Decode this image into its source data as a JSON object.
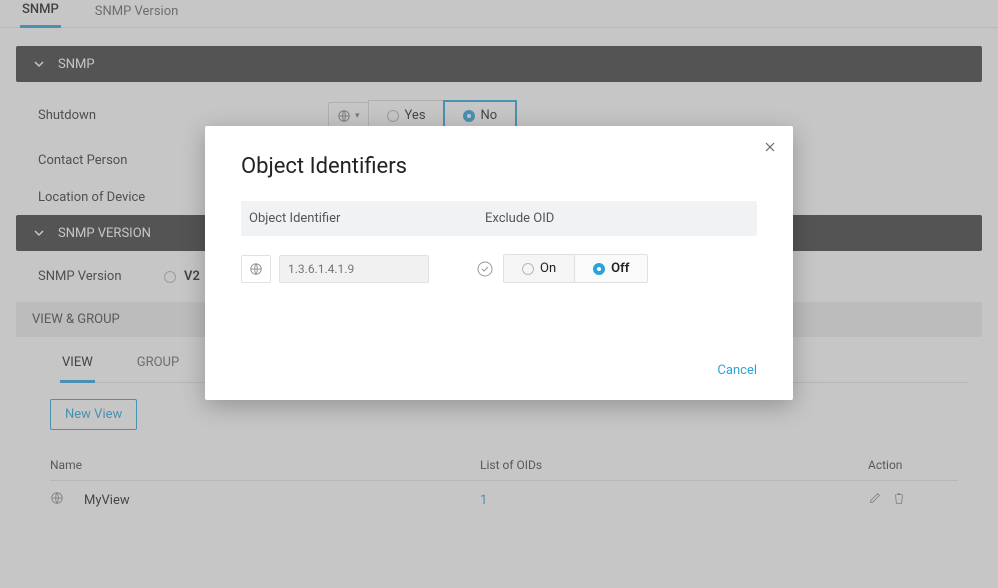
{
  "tabs": {
    "snmp": "SNMP",
    "version": "SNMP Version"
  },
  "panel1": {
    "title": "SNMP",
    "shutdown_label": "Shutdown",
    "yes": "Yes",
    "no": "No",
    "contact_label": "Contact Person",
    "location_label": "Location of Device"
  },
  "panel2": {
    "title": "SNMP VERSION",
    "ver_label": "SNMP Version",
    "ver_value": "V2",
    "viewgroup": "VIEW & GROUP",
    "view_tab": "VIEW",
    "group_tab": "GROUP",
    "new_view": "New View"
  },
  "table": {
    "h_name": "Name",
    "h_oid": "List of OIDs",
    "h_action": "Action",
    "rows": [
      {
        "name": "MyView",
        "oids": "1"
      }
    ]
  },
  "modal": {
    "title": "Object Identifiers",
    "col1": "Object Identifier",
    "col2": "Exclude OID",
    "placeholder": "1.3.6.1.4.1.9",
    "on": "On",
    "off": "Off",
    "cancel": "Cancel"
  }
}
